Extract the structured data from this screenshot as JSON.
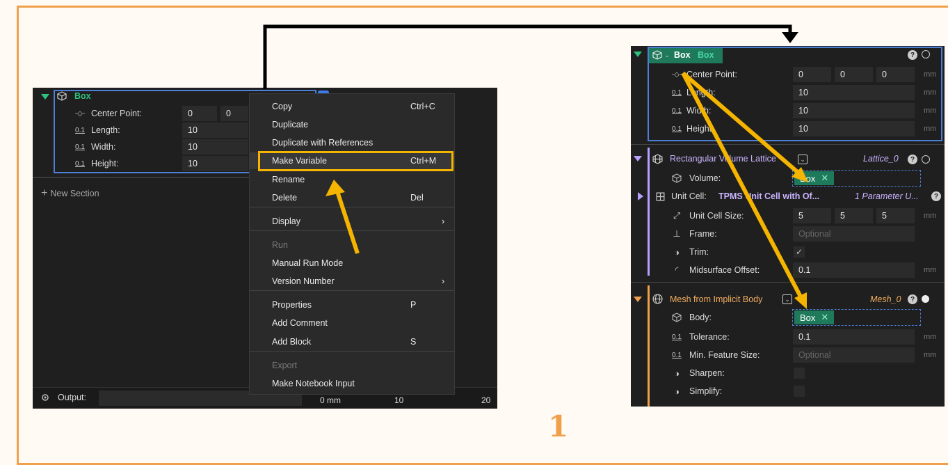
{
  "step_number": "1",
  "colors": {
    "frame": "#f0a04a",
    "arrow": "#f5b400",
    "panel": "#1f1f1f",
    "box_green": "#2ec27e",
    "lattice_purple": "#b7a0ff",
    "mesh_orange": "#f0a04a",
    "selection_blue": "#4d7fd6"
  },
  "left": {
    "block_title": "Box",
    "rows": [
      {
        "label": "Center Point:",
        "values": [
          "0",
          "0"
        ],
        "icon": "point-icon"
      },
      {
        "label": "Length:",
        "values": [
          "10"
        ],
        "icon": "scalar-icon"
      },
      {
        "label": "Width:",
        "values": [
          "10"
        ],
        "icon": "scalar-icon"
      },
      {
        "label": "Height:",
        "values": [
          "10"
        ],
        "icon": "scalar-icon"
      }
    ],
    "scalar_icon_text": "0.1",
    "point_icon_text": "-◇-",
    "new_section": "New Section",
    "output_label": "Output:",
    "ruler": {
      "zero": "0 mm",
      "ten": "10",
      "twenty": "20"
    }
  },
  "context_menu": {
    "items": [
      {
        "label": "Copy",
        "shortcut": "Ctrl+C"
      },
      {
        "label": "Duplicate",
        "shortcut": ""
      },
      {
        "label": "Duplicate with References",
        "shortcut": ""
      },
      {
        "label": "Make Variable",
        "shortcut": "Ctrl+M"
      },
      {
        "label": "Rename",
        "shortcut": ""
      },
      {
        "label": "Delete",
        "shortcut": "Del"
      },
      {
        "label": "Display",
        "shortcut": "›"
      },
      {
        "label": "Run",
        "shortcut": ""
      },
      {
        "label": "Manual Run Mode",
        "shortcut": ""
      },
      {
        "label": "Version Number",
        "shortcut": "›"
      },
      {
        "label": "Properties",
        "shortcut": "P"
      },
      {
        "label": "Add Comment",
        "shortcut": ""
      },
      {
        "label": "Add Block",
        "shortcut": "S"
      },
      {
        "label": "Export",
        "shortcut": ""
      },
      {
        "label": "Make Notebook Input",
        "shortcut": ""
      }
    ]
  },
  "right": {
    "box": {
      "title": "Box",
      "variable": "Box",
      "rows": [
        {
          "label": "Center Point:",
          "values": [
            "0",
            "0",
            "0"
          ],
          "unit": "mm"
        },
        {
          "label": "Length:",
          "values": [
            "10"
          ],
          "unit": "mm"
        },
        {
          "label": "Width:",
          "values": [
            "10"
          ],
          "unit": "mm"
        },
        {
          "label": "Height:",
          "values": [
            "10"
          ],
          "unit": "mm"
        }
      ]
    },
    "lattice": {
      "title": "Rectangular Volume Lattice",
      "name": "Lattice_0",
      "volume_label": "Volume:",
      "volume_tag": "Box",
      "unit_cell_label": "Unit Cell:",
      "unit_cell_value": "TPMS Unit Cell with Of...",
      "unit_cell_param": "1 Parameter U...",
      "unit_cell_size_label": "Unit Cell Size:",
      "unit_cell_size": [
        "5",
        "5",
        "5"
      ],
      "unit": "mm",
      "frame_label": "Frame:",
      "frame_placeholder": "Optional",
      "trim_label": "Trim:",
      "trim_check": "✓",
      "midsurface_label": "Midsurface Offset:",
      "midsurface_value": "0.1"
    },
    "mesh": {
      "title": "Mesh from Implicit Body",
      "name": "Mesh_0",
      "body_label": "Body:",
      "body_tag": "Box",
      "tolerance_label": "Tolerance:",
      "tolerance_value": "0.1",
      "unit": "mm",
      "min_feature_label": "Min. Feature Size:",
      "min_feature_placeholder": "Optional",
      "sharpen_label": "Sharpen:",
      "simplify_label": "Simplify:"
    }
  }
}
